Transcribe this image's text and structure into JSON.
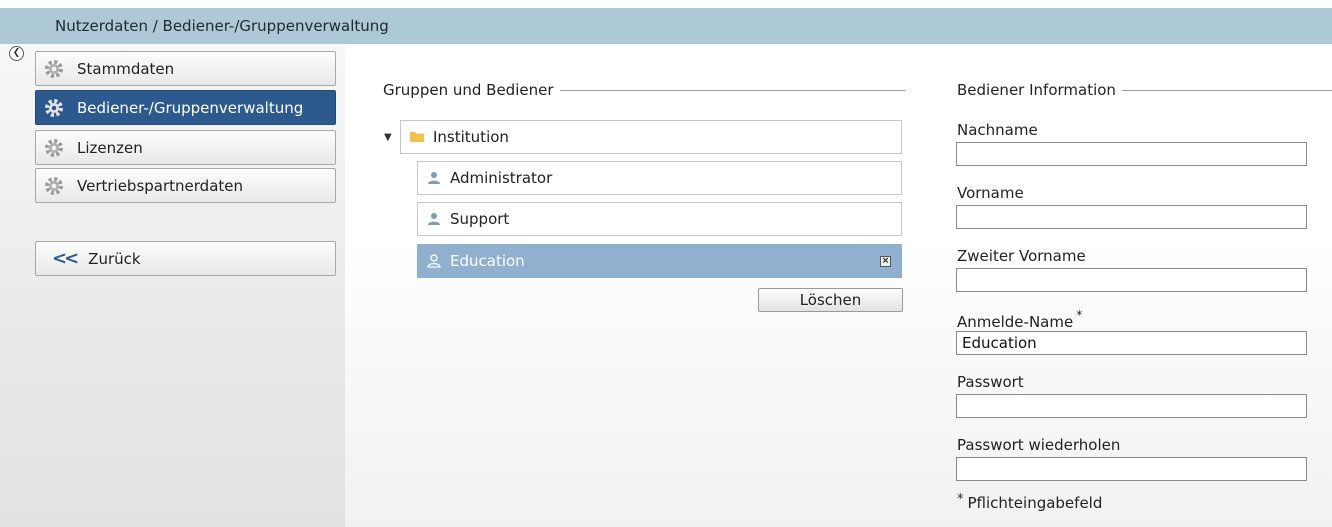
{
  "breadcrumb": "Nutzerdaten / Bediener-/Gruppenverwaltung",
  "sidebar": {
    "items": [
      {
        "label": "Stammdaten",
        "icon": "gear-icon"
      },
      {
        "label": "Bediener-/Gruppenverwaltung",
        "icon": "gear-icon",
        "active": true
      },
      {
        "label": "Lizenzen",
        "icon": "gear-icon"
      },
      {
        "label": "Vertriebspartnerdaten",
        "icon": "gear-icon"
      }
    ],
    "back_label": "Zurück"
  },
  "groups": {
    "title": "Gruppen und Bediener",
    "root": "Institution",
    "children": [
      "Administrator",
      "Support",
      "Education"
    ],
    "selected": "Education",
    "delete_label": "Löschen"
  },
  "info": {
    "title": "Bediener Information",
    "fields": [
      {
        "label": "Nachname",
        "value": "",
        "required": false
      },
      {
        "label": "Vorname",
        "value": "",
        "required": false
      },
      {
        "label": "Zweiter Vorname",
        "value": "",
        "required": false
      },
      {
        "label": "Anmelde-Name",
        "value": "Education",
        "required": true
      },
      {
        "label": "Passwort",
        "value": "",
        "required": false
      },
      {
        "label": "Passwort wiederholen",
        "value": "",
        "required": false
      }
    ],
    "required_star": "*",
    "required_note": "Pflichteingabefeld"
  },
  "colors": {
    "topbar": "#adc9d6",
    "active_nav": "#2c5a8e",
    "selected_node": "#8fb1cf",
    "folder": "#f2c24b"
  }
}
